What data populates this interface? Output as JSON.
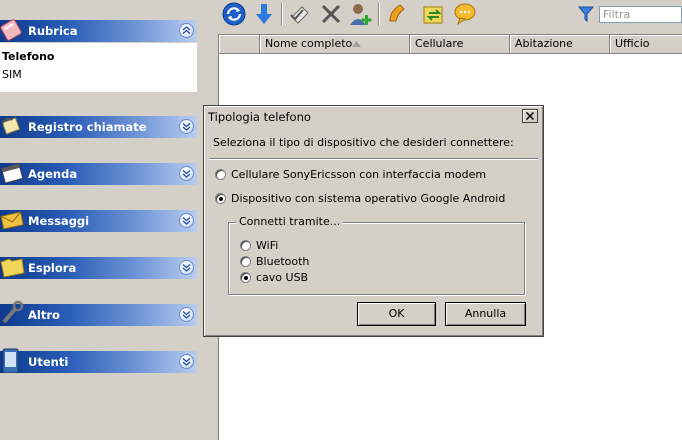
{
  "sidebar": {
    "sections": [
      {
        "id": "rubrica",
        "label": "Rubrica",
        "icon": "address-book-icon",
        "expanded": true
      },
      {
        "id": "registro",
        "label": "Registro chiamate",
        "icon": "call-log-icon",
        "expanded": false
      },
      {
        "id": "agenda",
        "label": "Agenda",
        "icon": "calendar-icon",
        "expanded": false
      },
      {
        "id": "messaggi",
        "label": "Messaggi",
        "icon": "envelope-icon",
        "expanded": false
      },
      {
        "id": "esplora",
        "label": "Esplora",
        "icon": "folder-icon",
        "expanded": false
      },
      {
        "id": "altro",
        "label": "Altro",
        "icon": "tools-icon",
        "expanded": false
      },
      {
        "id": "utenti",
        "label": "Utenti",
        "icon": "phone-device-icon",
        "expanded": false
      }
    ],
    "rubrica_items": [
      {
        "label": "Telefono",
        "selected": true
      },
      {
        "label": "SIM",
        "selected": false
      }
    ]
  },
  "toolbar": {
    "buttons": [
      "refresh-icon",
      "download-icon",
      "edit-check-icon",
      "delete-x-icon",
      "add-contact-icon",
      "call-icon",
      "sync-icon",
      "chat-icon"
    ],
    "filter_placeholder": "Filtra"
  },
  "table": {
    "columns": [
      "Nome completo",
      "Cellulare",
      "Abitazione",
      "Ufficio"
    ],
    "sorted_column": "Nome completo"
  },
  "dialog": {
    "title": "Tipologia telefono",
    "prompt": "Seleziona il tipo di dispositivo che desideri connettere:",
    "device_options": [
      {
        "label": "Cellulare SonyEricsson con interfaccia modem",
        "checked": false
      },
      {
        "label": "Dispositivo con sistema operativo Google Android",
        "checked": true
      }
    ],
    "connection_group_label": "Connetti tramite...",
    "connection_options": [
      {
        "label": "WiFi",
        "checked": false
      },
      {
        "label": "Bluetooth",
        "checked": false
      },
      {
        "label": "cavo USB",
        "checked": true
      }
    ],
    "ok_label": "OK",
    "cancel_label": "Annulla"
  },
  "colors": {
    "section_header_dark": "#0d3a8e",
    "section_header_light": "#b9cdef",
    "window_bg": "#d4d0c8"
  }
}
